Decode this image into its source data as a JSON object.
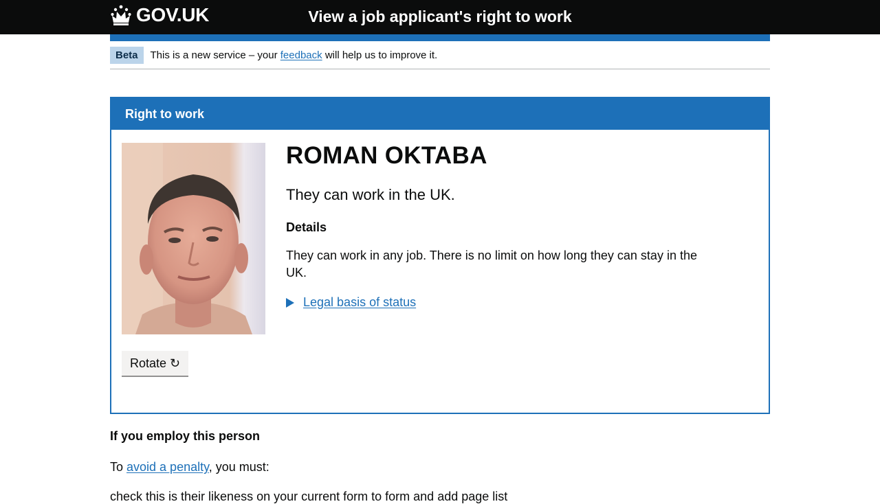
{
  "header": {
    "logo_text": "GOV.UK",
    "service_name": "View a job applicant's right to work"
  },
  "phase_banner": {
    "tag": "Beta",
    "text_before": "This is a new service – your ",
    "link": "feedback",
    "text_after": " will help us to improve it."
  },
  "card": {
    "heading": "Right to work",
    "name": "ROMAN OKTABA",
    "status": "They can work in the UK.",
    "details_heading": "Details",
    "details_text": "They can work in any job. There is no limit on how long they can stay in the UK.",
    "legal_link": "Legal basis of status",
    "rotate_label": "Rotate ↻"
  },
  "employment": {
    "heading": "If you employ this person",
    "text_before": "To ",
    "link": "avoid a penalty",
    "text_after": ", you must:",
    "cut_off_text": "check this is their likeness on your current form to form and add page list"
  },
  "colors": {
    "header_bg": "#0b0c0c",
    "brand_blue": "#1d70b8",
    "tag_bg": "#bbd4ea"
  }
}
